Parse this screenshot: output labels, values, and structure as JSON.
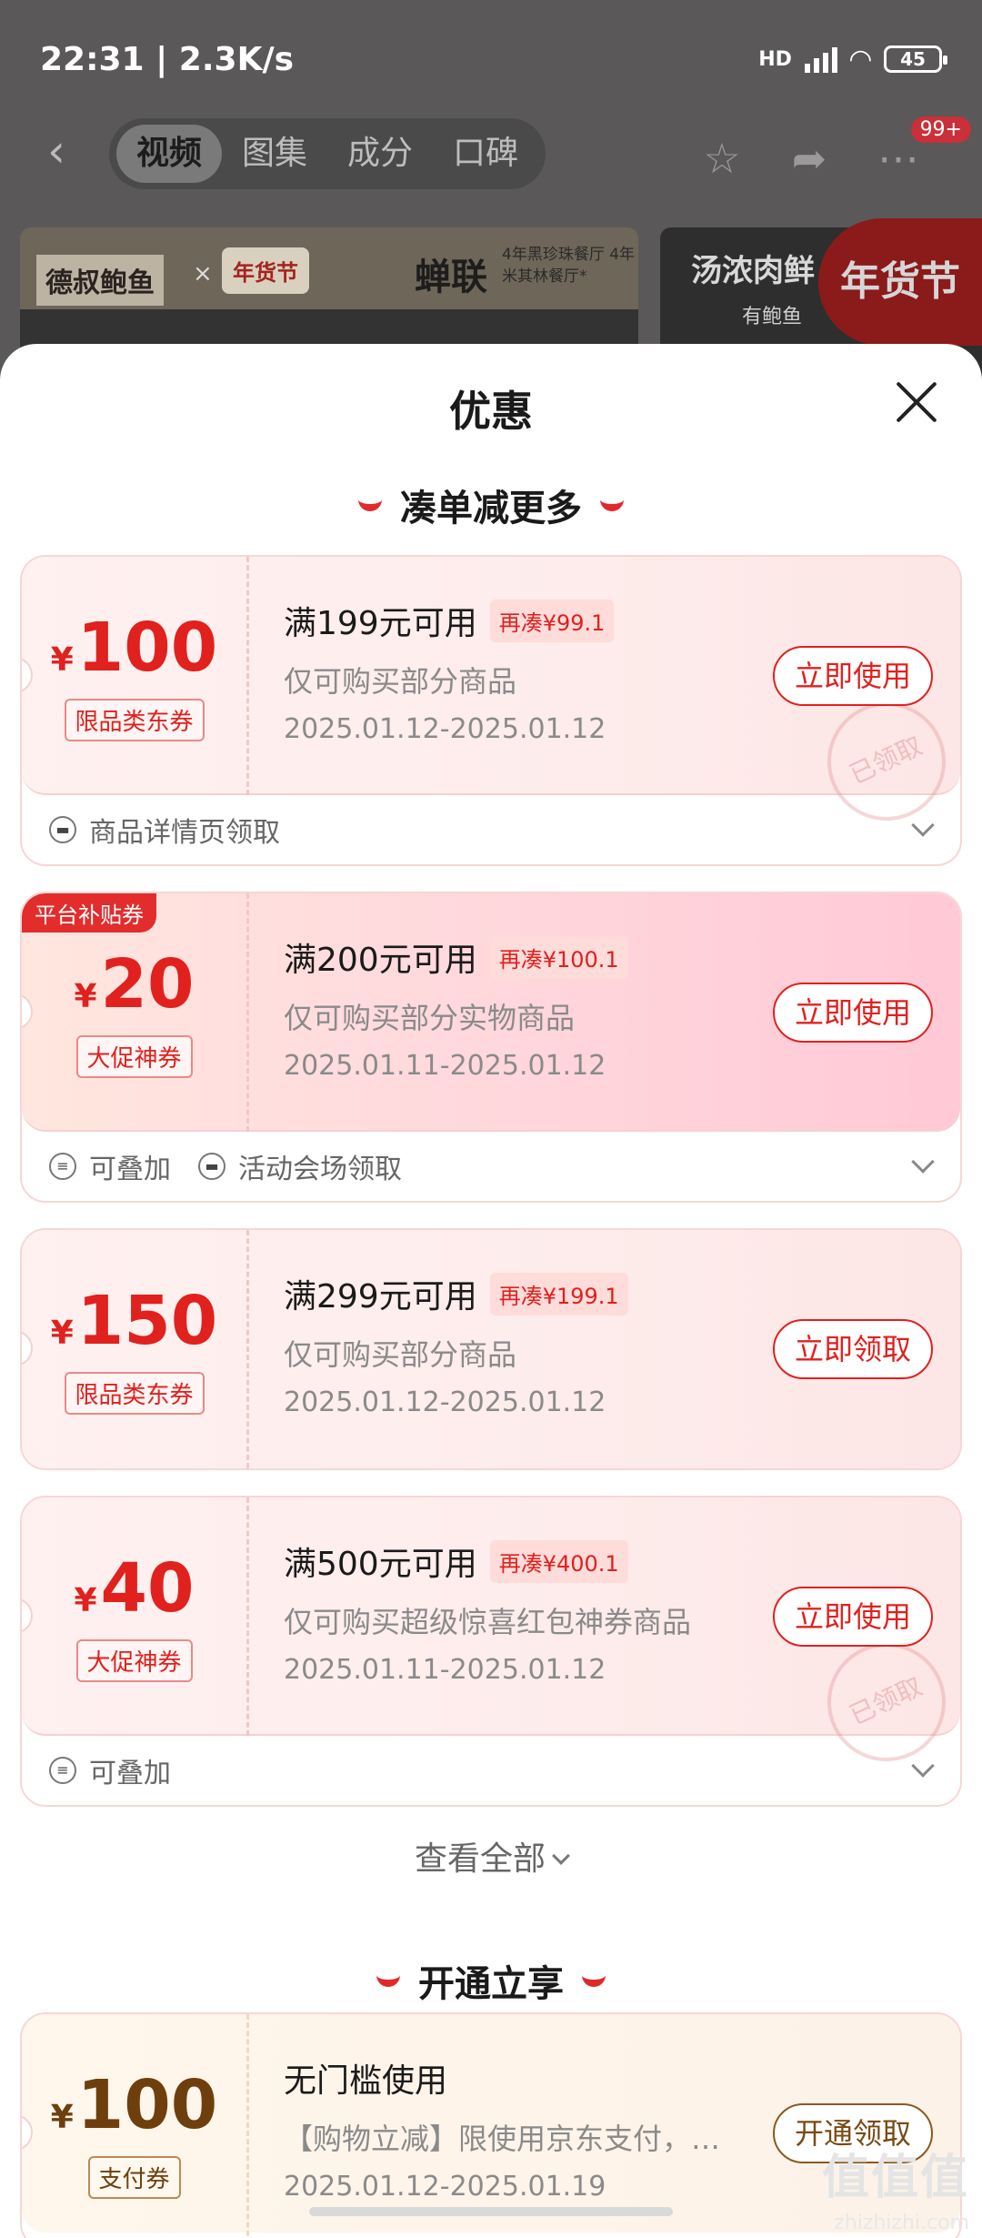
{
  "status": {
    "time": "22:31 | 2.3K/s",
    "network": "HD",
    "battery": "45"
  },
  "nav": {
    "tabs": [
      "视频",
      "图集",
      "成分",
      "口碑"
    ],
    "badge": "99+"
  },
  "banner": {
    "brand": "德叔鲍鱼",
    "x": "×",
    "tag": "年货节",
    "title": "蝉联",
    "sub": "4年黑珍珠餐厅 4年米其林餐厅*",
    "right_title": "汤浓肉鲜 汤",
    "right_sub": "有鲍鱼",
    "festival": "年货节"
  },
  "sheet": {
    "title": "优惠",
    "section1": "凑单减更多",
    "section2": "开通立享",
    "view_all": "查看全部"
  },
  "coupons": [
    {
      "amount": "100",
      "tag": "限品类东券",
      "cond": "满199元可用",
      "extra": "再凑¥99.1",
      "desc": "仅可购买部分商品",
      "date": "2025.01.12-2025.01.12",
      "btn": "立即使用",
      "stamp": "已领取",
      "foot": [
        "商品详情页领取"
      ]
    },
    {
      "corner": "平台补贴券",
      "amount": "20",
      "tag": "大促神券",
      "cond": "满200元可用",
      "extra": "再凑¥100.1",
      "desc": "仅可购买部分实物商品",
      "date": "2025.01.11-2025.01.12",
      "btn": "立即使用",
      "foot": [
        "可叠加",
        "活动会场领取"
      ]
    },
    {
      "amount": "150",
      "tag": "限品类东券",
      "cond": "满299元可用",
      "extra": "再凑¥199.1",
      "desc": "仅可购买部分商品",
      "date": "2025.01.12-2025.01.12",
      "btn": "立即领取"
    },
    {
      "amount": "40",
      "tag": "大促神券",
      "cond": "满500元可用",
      "extra": "再凑¥400.1",
      "desc": "仅可购买超级惊喜红包神券商品",
      "date": "2025.01.11-2025.01.12",
      "btn": "立即使用",
      "stamp": "已领取",
      "foot": [
        "可叠加"
      ]
    }
  ],
  "open_coupon": {
    "amount": "100",
    "tag": "支付券",
    "cond": "无门槛使用",
    "desc": "【购物立减】限使用京东支付，核…",
    "date": "2025.01.12-2025.01.19",
    "btn": "开通领取"
  },
  "watermark": {
    "main": "值值值",
    "sub": "zhizhizhi.com"
  },
  "yen": "¥"
}
